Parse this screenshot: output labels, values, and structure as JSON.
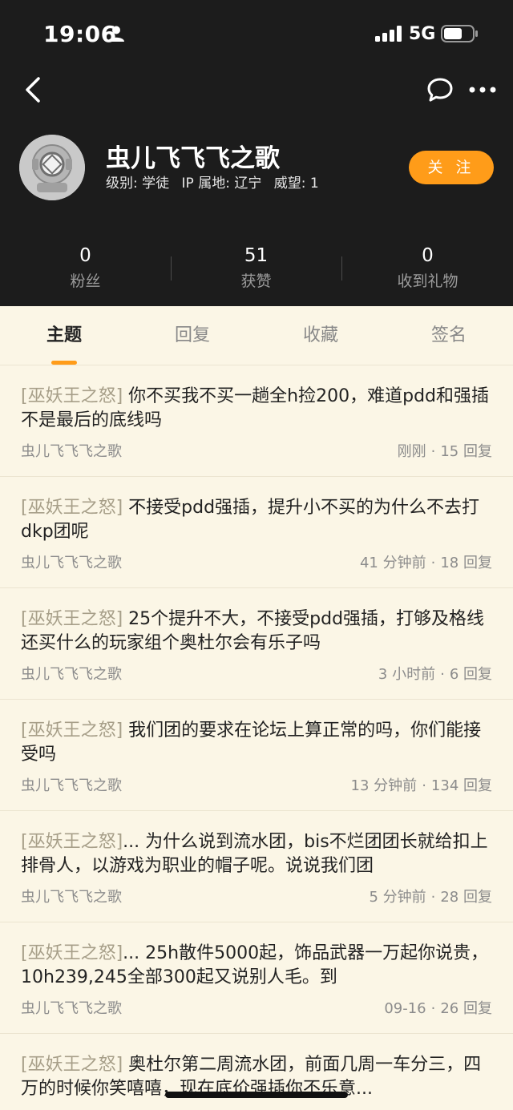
{
  "status_bar": {
    "time": "19:06",
    "network": "5G"
  },
  "profile": {
    "username": "虫儿飞飞飞之歌",
    "level": "级别: 学徒",
    "ip_location": "IP 属地: 辽宁",
    "prestige": "威望: 1",
    "follow_label": "关 注"
  },
  "stats": [
    {
      "value": "0",
      "label": "粉丝"
    },
    {
      "value": "51",
      "label": "获赞"
    },
    {
      "value": "0",
      "label": "收到礼物"
    }
  ],
  "tabs": [
    {
      "label": "主题",
      "active": true
    },
    {
      "label": "回复",
      "active": false
    },
    {
      "label": "收藏",
      "active": false
    },
    {
      "label": "签名",
      "active": false
    }
  ],
  "posts": [
    {
      "tag": "[巫妖王之怒]",
      "title": " 你不买我不买一趟全h捡200，难道pdd和强插不是最后的底线吗",
      "author": "虫儿飞飞飞之歌",
      "time": "刚刚",
      "replies": "15 回复"
    },
    {
      "tag": "[巫妖王之怒]",
      "title": " 不接受pdd强插，提升小不买的为什么不去打dkp团呢",
      "author": "虫儿飞飞飞之歌",
      "time": "41 分钟前",
      "replies": "18 回复"
    },
    {
      "tag": "[巫妖王之怒]",
      "title": " 25个提升不大，不接受pdd强插，打够及格线还买什么的玩家组个奥杜尔会有乐子吗",
      "author": "虫儿飞飞飞之歌",
      "time": "3 小时前",
      "replies": "6 回复"
    },
    {
      "tag": "[巫妖王之怒]",
      "title": " 我们团的要求在论坛上算正常的吗，你们能接受吗",
      "author": "虫儿飞飞飞之歌",
      "time": "13 分钟前",
      "replies": "134 回复"
    },
    {
      "tag": "[巫妖王之怒]",
      "title": "... 为什么说到流水团，bis不烂团团长就给扣上排骨人，以游戏为职业的帽子呢。说说我们团",
      "author": "虫儿飞飞飞之歌",
      "time": "5 分钟前",
      "replies": "28 回复"
    },
    {
      "tag": "[巫妖王之怒]",
      "title": "... 25h散件5000起，饰品武器一万起你说贵，10h239,245全部300起又说别人毛。到",
      "author": "虫儿飞飞飞之歌",
      "time": "09-16",
      "replies": "26 回复"
    },
    {
      "tag": "[巫妖王之怒]",
      "title": " 奥杜尔第二周流水团，前面几周一车分三，四万的时候你笑嘻嘻，现在底价强插你不乐意...",
      "author": "",
      "time": "",
      "replies": ""
    }
  ],
  "colors": {
    "header_bg": "#1c1c1c",
    "accent": "#ff9c19",
    "page_bg": "#fbf6e6",
    "tag": "#a79f89"
  },
  "icons": [
    "person-icon",
    "signal-icon",
    "battery-icon",
    "back-icon",
    "chat-icon",
    "more-icon"
  ]
}
